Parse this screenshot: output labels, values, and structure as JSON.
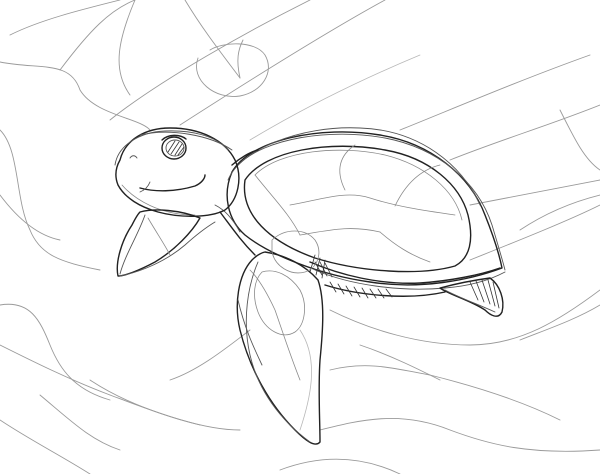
{
  "image": {
    "subject": "turtle-sketch",
    "colors": {
      "background": "#ffffff",
      "ink": "#222222",
      "faint": "#9a9a9a"
    }
  }
}
